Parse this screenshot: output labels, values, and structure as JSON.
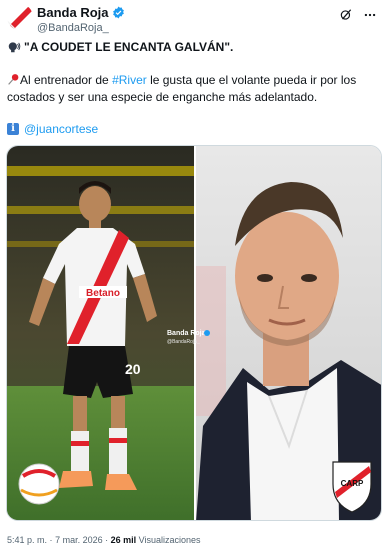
{
  "author": {
    "display_name": "Banda Roja",
    "handle": "@BandaRoja_"
  },
  "tweet": {
    "headline": "\"A COUDET LE ENCANTA GALVÁN\".",
    "body_prefix": "Al entrenador de ",
    "hashtag": "#River",
    "body_suffix": " le gusta que el volante pueda ir por los costados y ser una especie de enganche más adelantado.",
    "mention": "@juancortese"
  },
  "media": {
    "left_sponsor": "Betano",
    "left_number": "20",
    "watermark_name": "Banda Roja",
    "watermark_handle": "@BandaRoja_",
    "crest_text": "CARP"
  },
  "meta": {
    "time": "5:41 p. m.",
    "separator": "·",
    "date": "7 mar. 2026",
    "views_count": "26 mil",
    "views_label": "Visualizaciones"
  },
  "colors": {
    "accent": "#1d9bf0",
    "river_red": "#e0212b"
  },
  "icons": [
    "flag-icon",
    "verified-icon",
    "grok-icon",
    "more-icon",
    "speaking-head-icon",
    "pushpin-icon",
    "information-icon"
  ]
}
